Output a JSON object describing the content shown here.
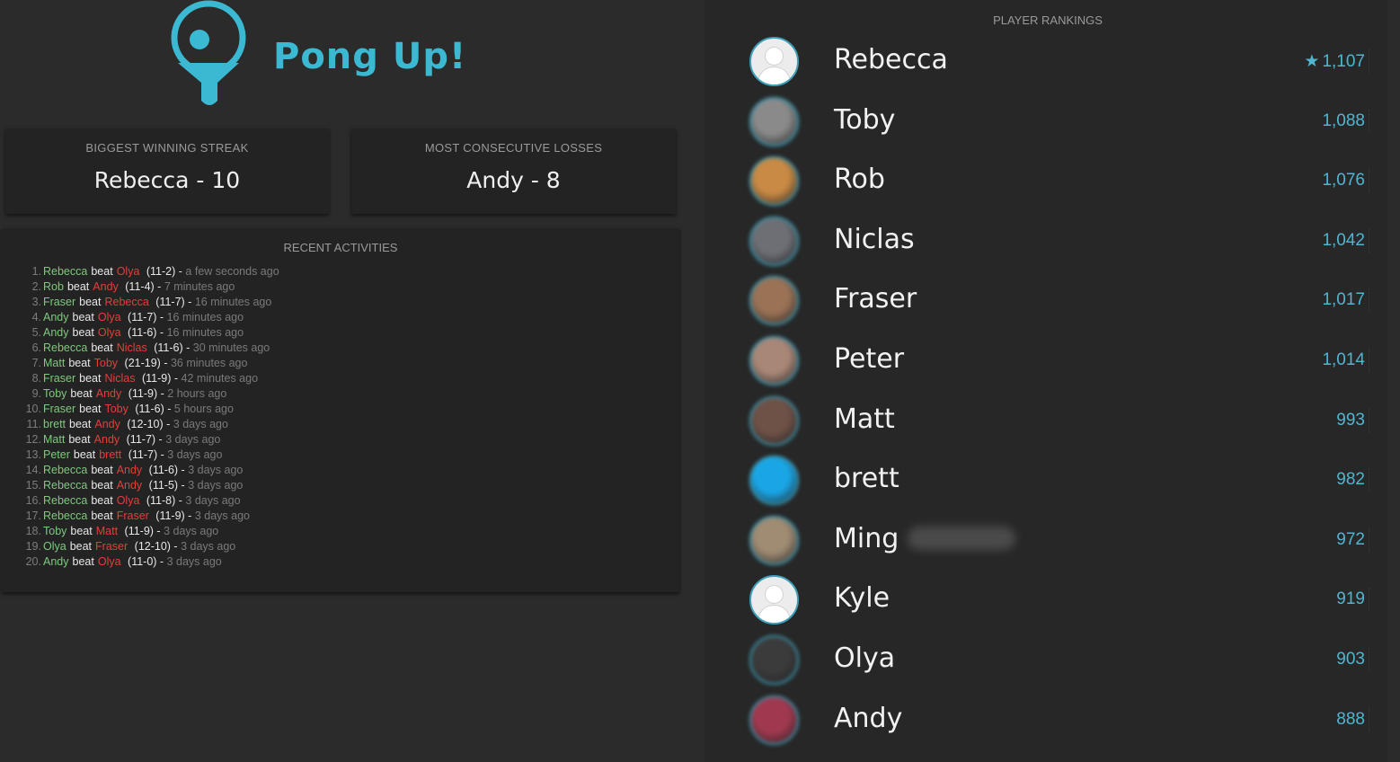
{
  "app": {
    "title": "Pong Up!"
  },
  "colors": {
    "accent": "#3bb9d2",
    "winner": "#7fc97f",
    "loser": "#e0403b"
  },
  "stats": {
    "winning_streak": {
      "title": "BIGGEST WINNING STREAK",
      "value": "Rebecca - 10"
    },
    "consecutive_losses": {
      "title": "MOST CONSECUTIVE LOSSES",
      "value": "Andy - 8"
    }
  },
  "activities": {
    "title": "RECENT ACTIVITIES",
    "items": [
      {
        "num": "1.",
        "winner": "Rebecca",
        "beat": "beat",
        "loser": "Olya",
        "score": "(11-2) -",
        "time": "a few seconds ago"
      },
      {
        "num": "2.",
        "winner": "Rob",
        "beat": "beat",
        "loser": "Andy",
        "score": "(11-4) -",
        "time": "7 minutes ago"
      },
      {
        "num": "3.",
        "winner": "Fraser",
        "beat": "beat",
        "loser": "Rebecca",
        "score": "(11-7) -",
        "time": "16 minutes ago"
      },
      {
        "num": "4.",
        "winner": "Andy",
        "beat": "beat",
        "loser": "Olya",
        "score": "(11-7) -",
        "time": "16 minutes ago"
      },
      {
        "num": "5.",
        "winner": "Andy",
        "beat": "beat",
        "loser": "Olya",
        "score": "(11-6) -",
        "time": "16 minutes ago"
      },
      {
        "num": "6.",
        "winner": "Rebecca",
        "beat": "beat",
        "loser": "Niclas",
        "score": "(11-6) -",
        "time": "30 minutes ago"
      },
      {
        "num": "7.",
        "winner": "Matt",
        "beat": "beat",
        "loser": "Toby",
        "score": "(21-19) -",
        "time": "36 minutes ago"
      },
      {
        "num": "8.",
        "winner": "Fraser",
        "beat": "beat",
        "loser": "Niclas",
        "score": "(11-9) -",
        "time": "42 minutes ago"
      },
      {
        "num": "9.",
        "winner": "Toby",
        "beat": "beat",
        "loser": "Andy",
        "score": "(11-9) -",
        "time": "2 hours ago"
      },
      {
        "num": "10.",
        "winner": "Fraser",
        "beat": "beat",
        "loser": "Toby",
        "score": "(11-6) -",
        "time": "5 hours ago"
      },
      {
        "num": "11.",
        "winner": "brett",
        "beat": "beat",
        "loser": "Andy",
        "score": "(12-10) -",
        "time": "3 days ago"
      },
      {
        "num": "12.",
        "winner": "Matt",
        "beat": "beat",
        "loser": "Andy",
        "score": "(11-7) -",
        "time": "3 days ago"
      },
      {
        "num": "13.",
        "winner": "Peter",
        "beat": "beat",
        "loser": "brett",
        "score": "(11-7) -",
        "time": "3 days ago"
      },
      {
        "num": "14.",
        "winner": "Rebecca",
        "beat": "beat",
        "loser": "Andy",
        "score": "(11-6) -",
        "time": "3 days ago"
      },
      {
        "num": "15.",
        "winner": "Rebecca",
        "beat": "beat",
        "loser": "Andy",
        "score": "(11-5) -",
        "time": "3 days ago"
      },
      {
        "num": "16.",
        "winner": "Rebecca",
        "beat": "beat",
        "loser": "Olya",
        "score": "(11-8) -",
        "time": "3 days ago"
      },
      {
        "num": "17.",
        "winner": "Rebecca",
        "beat": "beat",
        "loser": "Fraser",
        "score": "(11-9) -",
        "time": "3 days ago"
      },
      {
        "num": "18.",
        "winner": "Toby",
        "beat": "beat",
        "loser": "Matt",
        "score": "(11-9) -",
        "time": "3 days ago"
      },
      {
        "num": "19.",
        "winner": "Olya",
        "beat": "beat",
        "loser": "Fraser",
        "score": "(12-10) -",
        "time": "3 days ago"
      },
      {
        "num": "20.",
        "winner": "Andy",
        "beat": "beat",
        "loser": "Olya",
        "score": "(11-0) -",
        "time": "3 days ago"
      }
    ]
  },
  "rankings": {
    "title": "PLAYER RANKINGS",
    "players": [
      {
        "name": "Rebecca",
        "score": "1,107",
        "avatar": "default",
        "star": true
      },
      {
        "name": "Toby",
        "score": "1,088",
        "avatar": "photo",
        "color": "#8a8a8a"
      },
      {
        "name": "Rob",
        "score": "1,076",
        "avatar": "photo",
        "color": "#c98a45"
      },
      {
        "name": "Niclas",
        "score": "1,042",
        "avatar": "photo",
        "color": "#6d6f75"
      },
      {
        "name": "Fraser",
        "score": "1,017",
        "avatar": "photo",
        "color": "#9a7256"
      },
      {
        "name": "Peter",
        "score": "1,014",
        "avatar": "photo",
        "color": "#a98777"
      },
      {
        "name": "Matt",
        "score": "993",
        "avatar": "photo",
        "color": "#6e5147"
      },
      {
        "name": "brett",
        "score": "982",
        "avatar": "photo",
        "color": "#1aa6e6"
      },
      {
        "name": "Ming",
        "score": "972",
        "avatar": "photo",
        "color": "#a08b73"
      },
      {
        "name": "Kyle",
        "score": "919",
        "avatar": "default"
      },
      {
        "name": "Olya",
        "score": "903",
        "avatar": "photo",
        "color": "#3b3b3b"
      },
      {
        "name": "Andy",
        "score": "888",
        "avatar": "photo",
        "color": "#a0394f"
      }
    ]
  },
  "icons": {
    "logo": "paddle-logo-icon",
    "star": "star-icon",
    "default_avatar": "user-placeholder-icon"
  }
}
